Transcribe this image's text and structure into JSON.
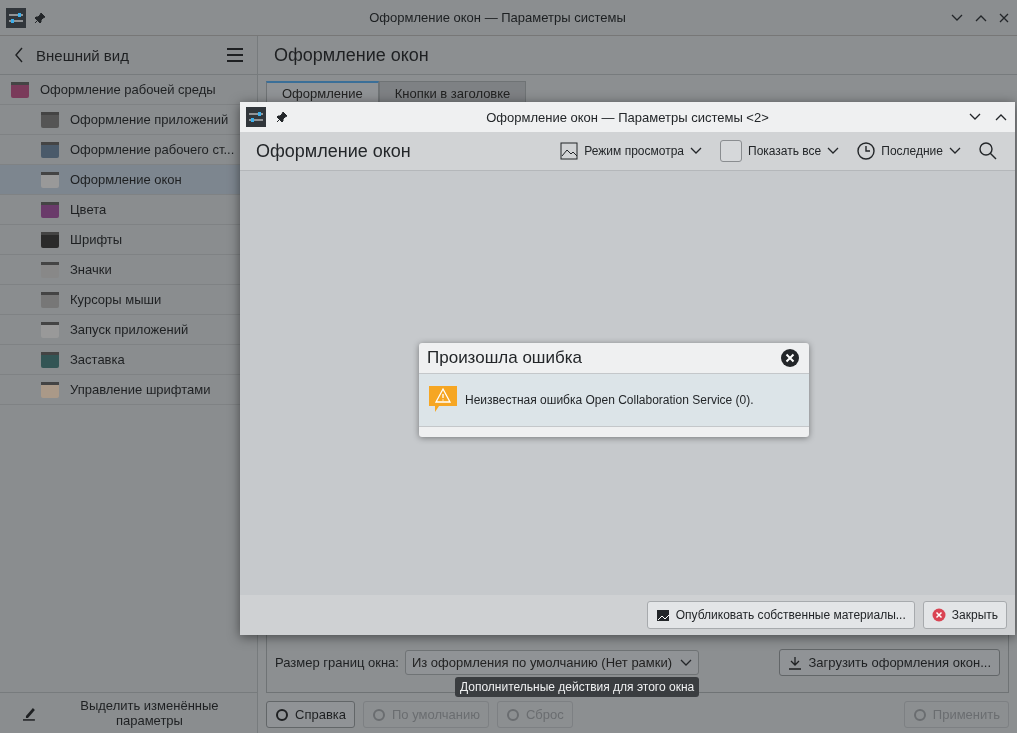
{
  "window": {
    "title": "Оформление окон — Параметры системы"
  },
  "sidebar": {
    "title": "Внешний вид",
    "items": [
      {
        "label": "Оформление рабочей среды",
        "selected": false,
        "children": [
          {
            "label": "Оформление приложений",
            "selected": false
          },
          {
            "label": "Оформление рабочего ст...",
            "selected": false
          },
          {
            "label": "Оформление окон",
            "selected": true
          },
          {
            "label": "Цвета",
            "selected": false
          },
          {
            "label": "Шрифты",
            "selected": false
          },
          {
            "label": "Значки",
            "selected": false
          },
          {
            "label": "Курсоры мыши",
            "selected": false
          },
          {
            "label": "Запуск приложений",
            "selected": false
          },
          {
            "label": "Заставка",
            "selected": false
          },
          {
            "label": "Управление шрифтами",
            "selected": false
          }
        ]
      }
    ],
    "footer_button": "Выделить изменённые параметры"
  },
  "page": {
    "title": "Оформление окон",
    "tabs": [
      {
        "label": "Оформление",
        "selected": true
      },
      {
        "label": "Кнопки в заголовке",
        "selected": false
      }
    ],
    "border_size": {
      "label": "Размер границ окна:",
      "value": "Из оформления по умолчанию (Нет рамки)"
    },
    "download_button": "Загрузить оформления окон...",
    "buttons": [
      {
        "label": "Справка",
        "disabled": false
      },
      {
        "label": "По умолчанию",
        "disabled": true
      },
      {
        "label": "Сброс",
        "disabled": true
      },
      {
        "label": "Применить",
        "disabled": true
      }
    ]
  },
  "dialog": {
    "title": "Оформление окон — Параметры системы <2>",
    "heading": "Оформление окон",
    "view_mode": "Режим просмотра",
    "show_all": {
      "label": "Показать все",
      "checked": false
    },
    "sort": "Последние",
    "publish_button": "Опубликовать собственные материалы...",
    "close_button": "Закрыть"
  },
  "error": {
    "title": "Произошла ошибка",
    "message": "Неизвестная ошибка Open Collaboration Service (0)."
  },
  "tooltip": "Дополнительные действия для этого окна"
}
